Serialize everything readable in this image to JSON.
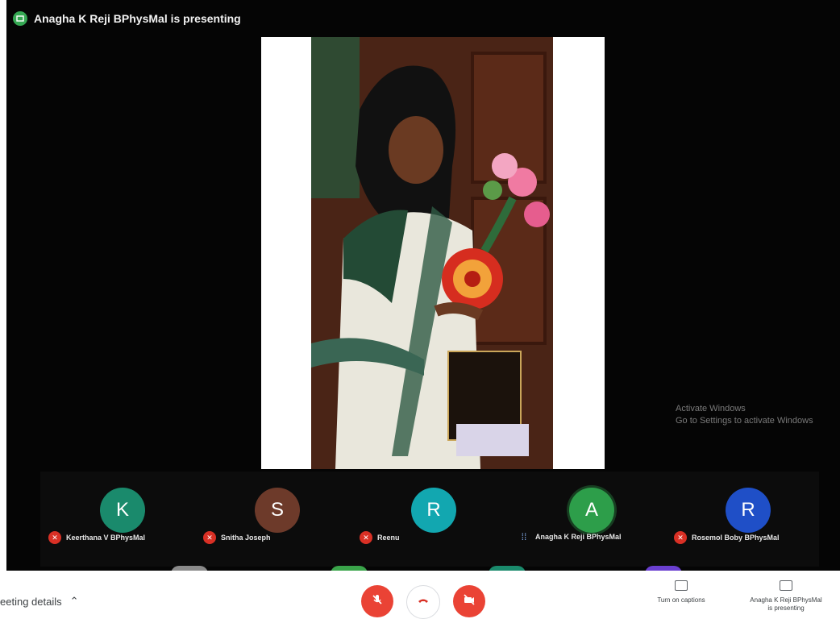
{
  "presenter_banner": "Anagha K Reji BPhysMal is presenting",
  "watermark": {
    "title": "Activate Windows",
    "subtitle": "Go to Settings to activate Windows"
  },
  "participants": [
    {
      "initial": "K",
      "name": "Keerthana V BPhysMal",
      "color": "#1a8a6c",
      "muted": true
    },
    {
      "initial": "S",
      "name": "Snitha Joseph",
      "color": "#6d3a2a",
      "muted": true
    },
    {
      "initial": "R",
      "name": "Reenu",
      "color": "#12a7b0",
      "muted": true
    },
    {
      "initial": "A",
      "name": "Anagha K Reji BPhysMal",
      "color": "#2d9e4a",
      "muted": false
    },
    {
      "initial": "R",
      "name": "Rosemol Boby BPhysMal",
      "color": "#1f4fc7",
      "muted": true
    }
  ],
  "bottom_bar": {
    "meeting_details": "eeting details",
    "captions_label": "Turn on captions",
    "presenting_label_line1": "Anagha K Reji BPhysMal",
    "presenting_label_line2": "is presenting"
  },
  "colors": {
    "accent_red": "#ea4335",
    "stage_bg": "#050505",
    "presenter_green": "#35a853"
  }
}
